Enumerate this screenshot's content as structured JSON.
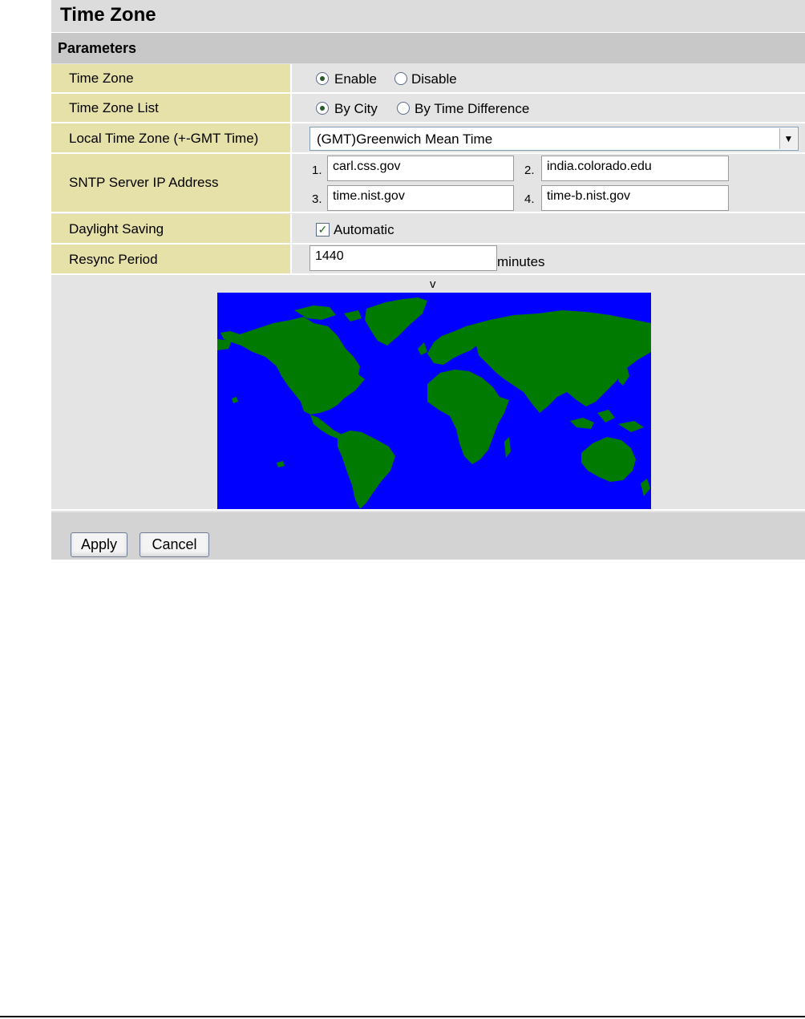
{
  "header": {
    "title": "Time Zone",
    "section": "Parameters"
  },
  "time_zone": {
    "label": "Time Zone",
    "option_enable": "Enable",
    "option_disable": "Disable",
    "selected": "Enable"
  },
  "time_zone_list": {
    "label": "Time Zone List",
    "option_city": "By City",
    "option_diff": "By Time Difference",
    "selected": "By City"
  },
  "local_time_zone": {
    "label": "Local Time Zone (+-GMT Time)",
    "value": "(GMT)Greenwich Mean Time"
  },
  "sntp": {
    "label": "SNTP Server IP Address",
    "servers": [
      {
        "num": "1.",
        "value": "carl.css.gov"
      },
      {
        "num": "2.",
        "value": "india.colorado.edu"
      },
      {
        "num": "3.",
        "value": "time.nist.gov"
      },
      {
        "num": "4.",
        "value": "time-b.nist.gov"
      }
    ]
  },
  "daylight_saving": {
    "label": "Daylight Saving",
    "option": "Automatic",
    "checked": true
  },
  "resync": {
    "label": "Resync Period",
    "value": "1440",
    "unit": "minutes"
  },
  "map": {
    "marker": "v",
    "ocean_color": "#0000ff",
    "land_color": "#007a00"
  },
  "buttons": {
    "apply": "Apply",
    "cancel": "Cancel"
  }
}
